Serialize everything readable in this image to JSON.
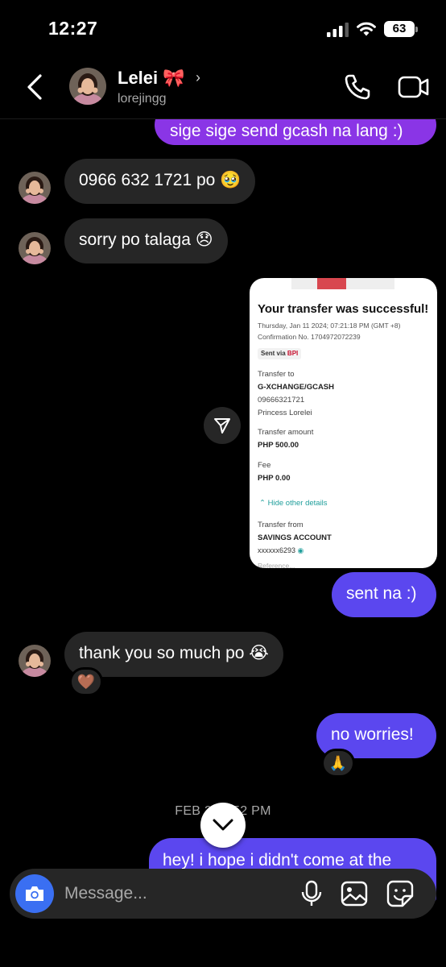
{
  "status_bar": {
    "time": "12:27",
    "battery": "63"
  },
  "header": {
    "contact_name": "Lelei 🎀",
    "contact_handle": "lorejingg",
    "chevron": "›"
  },
  "messages": [
    {
      "id": "m0",
      "direction": "outgoing",
      "text": "sige sige send gcash na lang :)"
    },
    {
      "id": "m1",
      "direction": "incoming",
      "text": "0966 632 1721 po 🥹"
    },
    {
      "id": "m2",
      "direction": "incoming",
      "text": "sorry po talaga 😞"
    },
    {
      "id": "m3",
      "direction": "outgoing",
      "text": "sent na :)"
    },
    {
      "id": "m4",
      "direction": "incoming",
      "text": "thank you so much po 😭",
      "reaction": "🤎"
    },
    {
      "id": "m5",
      "direction": "outgoing",
      "text": "no worries!",
      "reaction": "🙏"
    },
    {
      "id": "m6",
      "direction": "outgoing",
      "text": "hey! i hope i didn't come at the"
    }
  ],
  "receipt": {
    "title": "Your transfer was successful!",
    "datetime": "Thursday, Jan 11 2024; 07:21:18 PM (GMT +8)",
    "confirmation": "Confirmation No. 1704972072239",
    "sent_via_label": "Sent via",
    "sent_via_bank": "BPI",
    "transfer_to_label": "Transfer to",
    "transfer_to_name": "G-XCHANGE/GCASH",
    "transfer_to_number": "09666321721",
    "transfer_to_recipient": "Princess Lorelei",
    "amount_label": "Transfer amount",
    "amount_value": "PHP 500.00",
    "fee_label": "Fee",
    "fee_value": "PHP 0.00",
    "hide_details": "Hide other details",
    "transfer_from_label": "Transfer from",
    "transfer_from_account": "SAVINGS ACCOUNT",
    "transfer_from_number": "xxxxxx6293",
    "reference_partial": "Reference..."
  },
  "timestamp": "FEB 2 … 52 PM",
  "composer": {
    "placeholder": "Message..."
  },
  "colors": {
    "outgoing_bubble": "#5b47ef",
    "outgoing_bubble_older": "#8a35e6",
    "incoming_bubble": "#262626",
    "camera_button": "#3a6ff2",
    "bpi_red": "#c8102e",
    "link_teal": "#1f9e9b"
  },
  "icons": {
    "back": "back-arrow-icon",
    "call": "phone-icon",
    "video": "video-camera-icon",
    "share": "share-icon",
    "scroll": "chevron-down-icon",
    "camera": "camera-icon",
    "mic": "microphone-icon",
    "gallery": "gallery-icon",
    "sticker": "sticker-icon"
  }
}
